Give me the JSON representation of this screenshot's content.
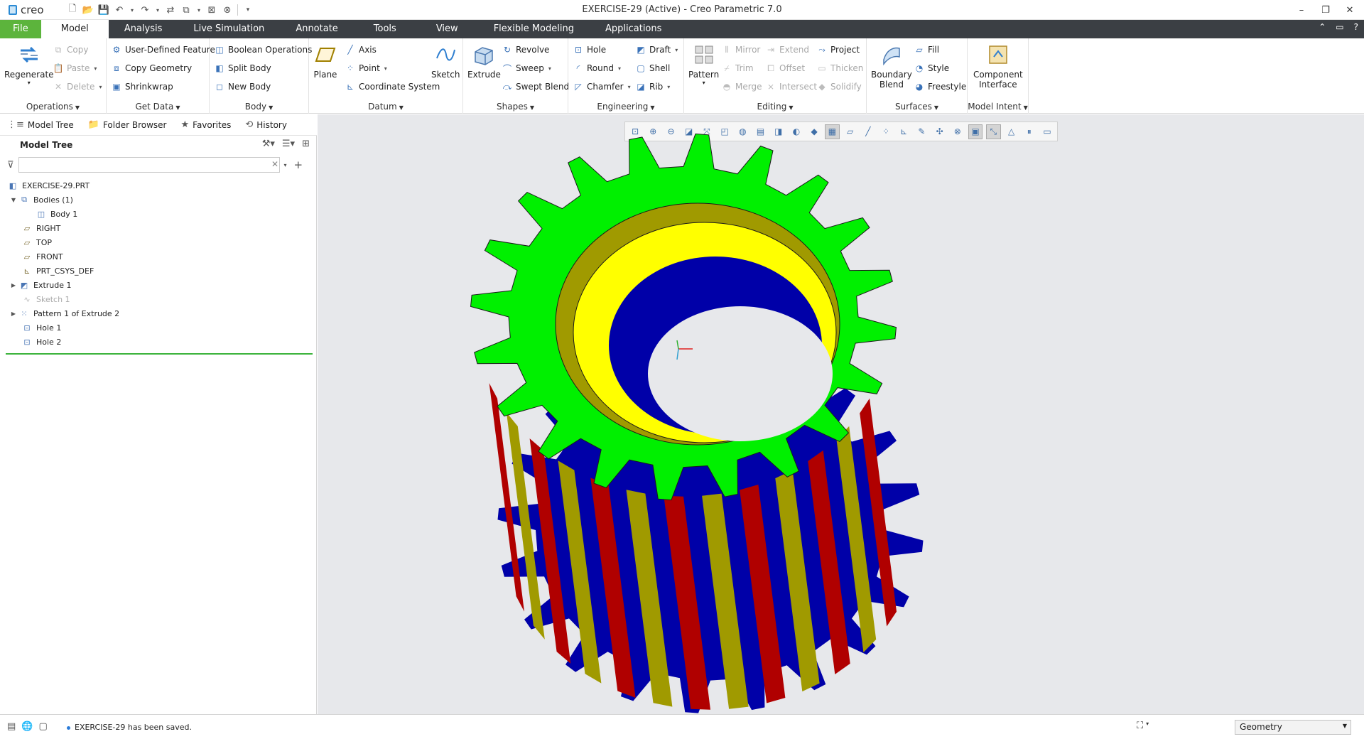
{
  "app": {
    "logo_text": "creo",
    "window_title": "EXERCISE-29 (Active) - Creo Parametric 7.0"
  },
  "tabs": [
    {
      "label": "File"
    },
    {
      "label": "Model"
    },
    {
      "label": "Analysis"
    },
    {
      "label": "Live Simulation"
    },
    {
      "label": "Annotate"
    },
    {
      "label": "Tools"
    },
    {
      "label": "View"
    },
    {
      "label": "Flexible Modeling"
    },
    {
      "label": "Applications"
    }
  ],
  "ribbon": {
    "operations": {
      "label": "Operations",
      "regenerate": "Regenerate",
      "copy": "Copy",
      "paste": "Paste",
      "delete": "Delete"
    },
    "get_data": {
      "label": "Get Data",
      "udf": "User-Defined Feature",
      "copy_geometry": "Copy Geometry",
      "shrinkwrap": "Shrinkwrap"
    },
    "body": {
      "label": "Body",
      "boolean": "Boolean Operations",
      "split": "Split Body",
      "new": "New Body"
    },
    "datum": {
      "label": "Datum",
      "plane": "Plane",
      "axis": "Axis",
      "point": "Point",
      "csys": "Coordinate System",
      "sketch": "Sketch"
    },
    "shapes": {
      "label": "Shapes",
      "extrude": "Extrude",
      "revolve": "Revolve",
      "sweep": "Sweep",
      "swept_blend": "Swept Blend"
    },
    "engineering": {
      "label": "Engineering",
      "hole": "Hole",
      "round": "Round",
      "chamfer": "Chamfer",
      "draft": "Draft",
      "shell": "Shell",
      "rib": "Rib"
    },
    "editing": {
      "label": "Editing",
      "pattern": "Pattern",
      "mirror": "Mirror",
      "trim": "Trim",
      "merge": "Merge",
      "extend": "Extend",
      "offset": "Offset",
      "intersect": "Intersect",
      "project": "Project",
      "thicken": "Thicken",
      "solidify": "Solidify"
    },
    "surfaces": {
      "label": "Surfaces",
      "boundary_blend_1": "Boundary",
      "boundary_blend_2": "Blend",
      "fill": "Fill",
      "style": "Style",
      "freestyle": "Freestyle"
    },
    "model_intent": {
      "label": "Model Intent",
      "component_1": "Component",
      "component_2": "Interface"
    }
  },
  "panel_tabs": [
    {
      "label": "Model Tree"
    },
    {
      "label": "Folder Browser"
    },
    {
      "label": "Favorites"
    },
    {
      "label": "History"
    }
  ],
  "model_tree": {
    "title": "Model Tree",
    "filter_value": "",
    "items": [
      {
        "label": "EXERCISE-29.PRT"
      },
      {
        "label": "Bodies (1)"
      },
      {
        "label": "Body 1"
      },
      {
        "label": "RIGHT"
      },
      {
        "label": "TOP"
      },
      {
        "label": "FRONT"
      },
      {
        "label": "PRT_CSYS_DEF"
      },
      {
        "label": "Extrude 1"
      },
      {
        "label": "Sketch 1"
      },
      {
        "label": "Pattern 1 of Extrude 2"
      },
      {
        "label": "Hole 1"
      },
      {
        "label": "Hole 2"
      }
    ]
  },
  "status": {
    "message": "EXERCISE-29 has been saved.",
    "filter_value": "Geometry"
  },
  "colors": {
    "gear_face": "#00f000",
    "gear_side": "#0000a8",
    "gear_edge_dark": "#a09a00",
    "gear_edge_red": "#b00000",
    "bore_face": "#ffff00",
    "file_tab": "#5cb43c",
    "tab_bar": "#3b3f44"
  }
}
